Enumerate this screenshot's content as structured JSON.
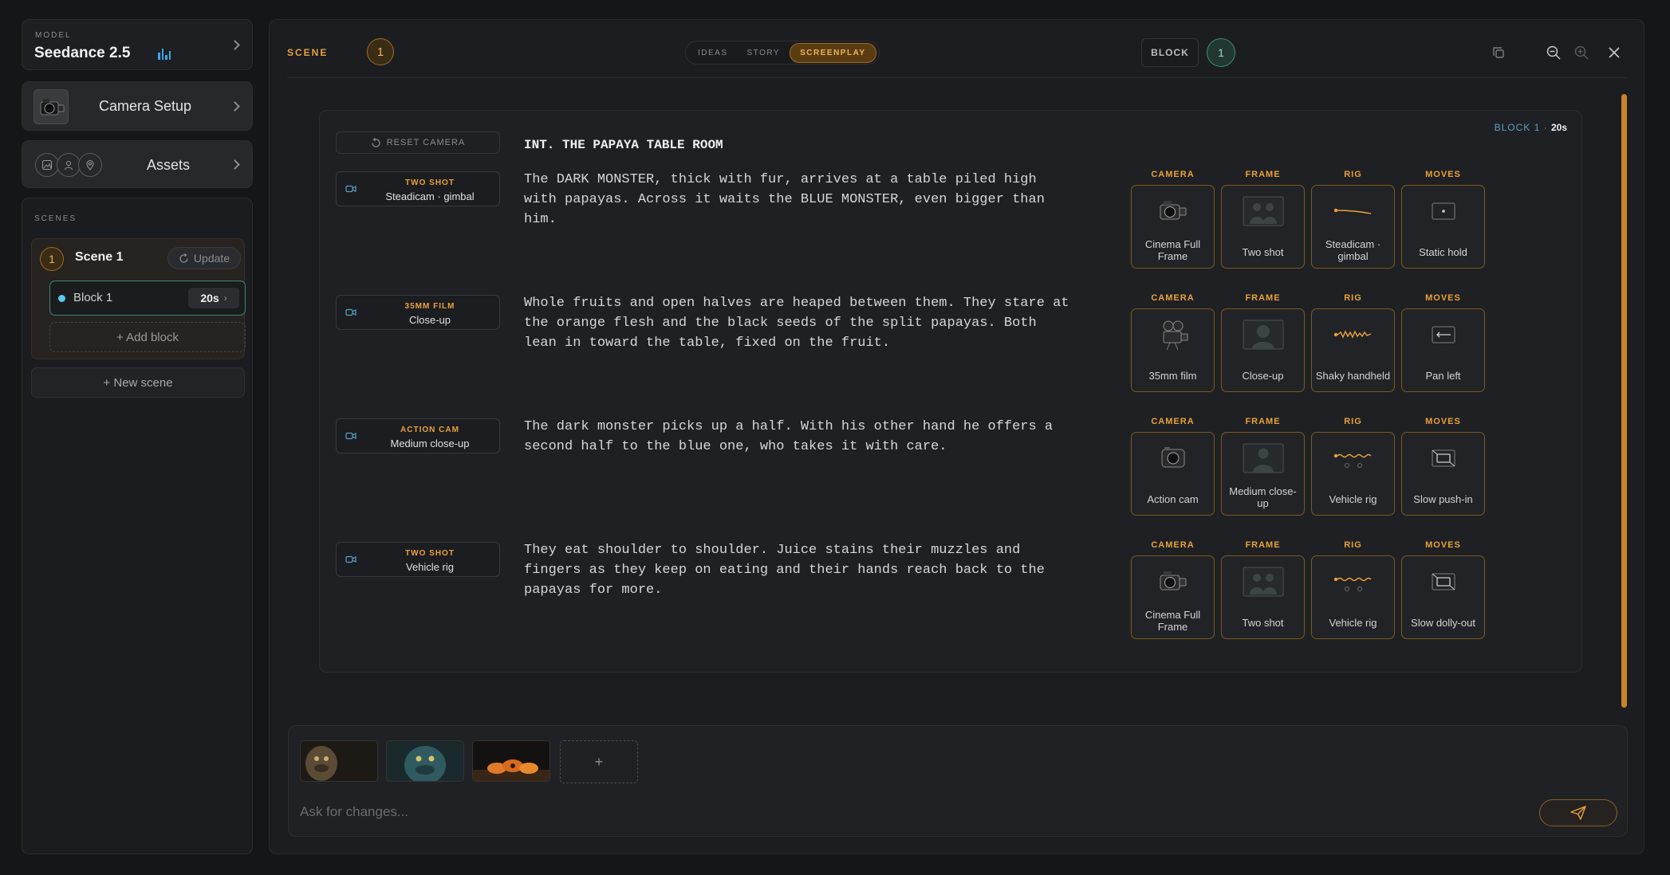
{
  "model": {
    "label": "MODEL",
    "name": "Seedance 2.5"
  },
  "sidebar": {
    "camera_setup": "Camera Setup",
    "assets": "Assets",
    "scenes_label": "SCENES",
    "scene": {
      "number": "1",
      "title": "Scene 1",
      "update_label": "Update",
      "block": {
        "label": "Block 1",
        "duration": "20s"
      },
      "add_block": "+ Add block"
    },
    "new_scene": "+ New scene"
  },
  "header": {
    "scene_label": "SCENE",
    "scene_number": "1",
    "tabs": [
      {
        "label": "IDEAS",
        "active": false
      },
      {
        "label": "STORY",
        "active": false
      },
      {
        "label": "SCREENPLAY",
        "active": true
      }
    ],
    "block_label": "BLOCK",
    "block_number": "1"
  },
  "content": {
    "block_corner": {
      "label": "BLOCK 1",
      "sep": "·",
      "duration": "20s"
    },
    "reset_camera": "RESET CAMERA",
    "slugline": "INT. THE PAPAYA TABLE ROOM",
    "option_headers": [
      "CAMERA",
      "FRAME",
      "RIG",
      "MOVES"
    ],
    "shots": [
      {
        "tag_type": "TWO SHOT",
        "tag_detail": "Steadicam · gimbal",
        "text": "The DARK MONSTER, thick with fur, arrives at a table piled high with papayas. Across it waits the BLUE MONSTER, even bigger than him.",
        "options": [
          "Cinema Full Frame",
          "Two shot",
          "Steadicam · gimbal",
          "Static hold"
        ]
      },
      {
        "tag_type": "35MM FILM",
        "tag_detail": "Close-up",
        "text": "Whole fruits and open halves are heaped between them. They stare at the orange flesh and the black seeds of the split papayas. Both lean in toward the table, fixed on the fruit.",
        "options": [
          "35mm film",
          "Close-up",
          "Shaky handheld",
          "Pan left"
        ]
      },
      {
        "tag_type": "ACTION CAM",
        "tag_detail": "Medium close-up",
        "text": "The dark monster picks up a half. With his other hand he offers a second half to the blue one, who takes it with care.",
        "options": [
          "Action cam",
          "Medium close-up",
          "Vehicle rig",
          "Slow push-in"
        ]
      },
      {
        "tag_type": "TWO SHOT",
        "tag_detail": "Vehicle rig",
        "text": "They eat shoulder to shoulder. Juice stains their muzzles and fingers as they keep on eating and their hands reach back to the papayas for more.",
        "options": [
          "Cinema Full Frame",
          "Two shot",
          "Vehicle rig",
          "Slow dolly-out"
        ]
      }
    ]
  },
  "composer": {
    "add_label": "+",
    "placeholder": "Ask for changes..."
  },
  "colors": {
    "accent": "#e9a23b",
    "teal": "#3b8a73",
    "blue": "#3aa6e8"
  }
}
